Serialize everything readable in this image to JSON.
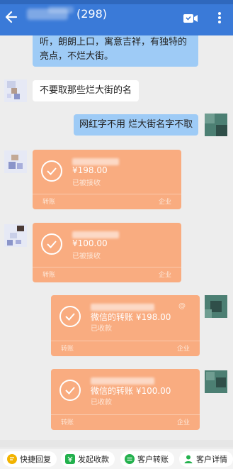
{
  "header": {
    "member_count": "(298)"
  },
  "messages": {
    "m1_line1": "听，朗朗上口，寓意吉祥，有独特的",
    "m1_line2": "亮点，不烂大街。",
    "m2": "不要取那些烂大街的名",
    "m3": "网红字不用  烂大街名字不取"
  },
  "transfers": [
    {
      "amount": "¥198.00",
      "status": "已被接收",
      "left_label": "转账",
      "right_label": "企业"
    },
    {
      "amount": "¥100.00",
      "status": "已被接收",
      "left_label": "转账",
      "right_label": "企业"
    },
    {
      "title": "微信的转账 ¥198.00",
      "status": "已收款",
      "left_label": "转账",
      "right_label": "企业",
      "at": "@"
    },
    {
      "title": "微信的转账 ¥100.00",
      "status": "已收款",
      "left_label": "转账",
      "right_label": "企业"
    }
  ],
  "quick_actions": [
    {
      "label": "快捷回复",
      "icon": "quick-reply-icon",
      "color": "#f2b300"
    },
    {
      "label": "发起收款",
      "icon": "payment-request-icon",
      "color": "#23b14d"
    },
    {
      "label": "客户转账",
      "icon": "transfer-icon",
      "color": "#23b14d"
    },
    {
      "label": "客户详情",
      "icon": "customer-detail-icon",
      "color": "#23b14d"
    }
  ],
  "colors": {
    "header_bg": "#3a7ad8",
    "bubble_sent": "#9ecbf6",
    "transfer_card": "#f9ac80",
    "chat_bg": "#ededed"
  }
}
